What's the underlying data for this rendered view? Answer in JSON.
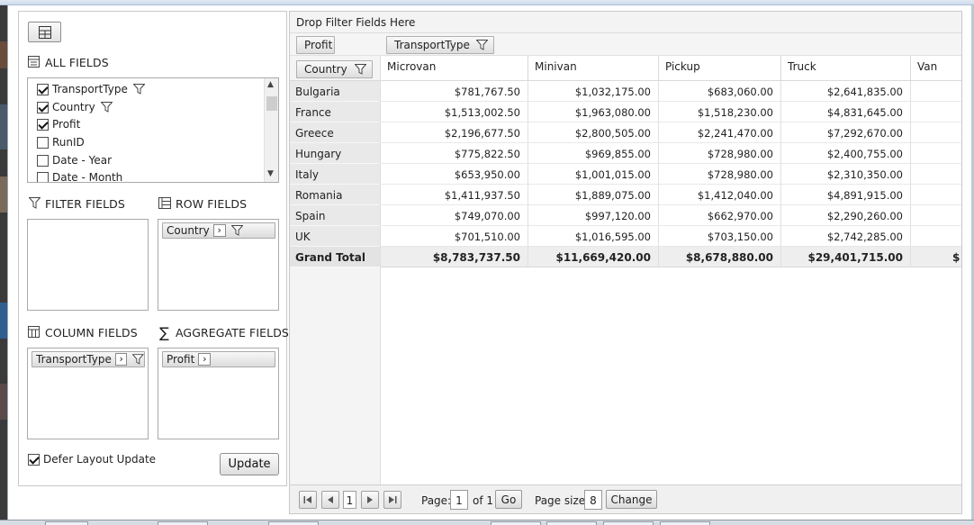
{
  "left_panel": {
    "all_fields_label": "ALL FIELDS",
    "fields": [
      {
        "label": "TransportType",
        "checked": true,
        "filtered": true
      },
      {
        "label": "Country",
        "checked": true,
        "filtered": true
      },
      {
        "label": "Profit",
        "checked": true,
        "filtered": false
      },
      {
        "label": "RunID",
        "checked": false,
        "filtered": false
      },
      {
        "label": "Date - Year",
        "checked": false,
        "filtered": false
      },
      {
        "label": "Date - Month",
        "checked": false,
        "filtered": false
      }
    ],
    "filter_fields_label": "FILTER FIELDS",
    "row_fields_label": "ROW FIELDS",
    "row_field_chip": "Country",
    "column_fields_label": "COLUMN FIELDS",
    "column_field_chip": "TransportType",
    "aggregate_fields_label": "AGGREGATE FIELDS",
    "aggregate_field_chip": "Profit",
    "defer_label": "Defer Layout Update",
    "defer_checked": true,
    "update_label": "Update"
  },
  "grid": {
    "drop_filter_text": "Drop Filter Fields Here",
    "measure_chip": "Profit",
    "column_chip": "TransportType",
    "row_chip": "Country",
    "columns": [
      "Microvan",
      "Minivan",
      "Pickup",
      "Truck",
      "Van"
    ],
    "rows": [
      {
        "label": "Bulgaria",
        "values": [
          "$781,767.50",
          "$1,032,175.00",
          "$683,060.00",
          "$2,641,835.00"
        ]
      },
      {
        "label": "France",
        "values": [
          "$1,513,002.50",
          "$1,963,080.00",
          "$1,518,230.00",
          "$4,831,645.00"
        ]
      },
      {
        "label": "Greece",
        "values": [
          "$2,196,677.50",
          "$2,800,505.00",
          "$2,241,470.00",
          "$7,292,670.00"
        ]
      },
      {
        "label": "Hungary",
        "values": [
          "$775,822.50",
          "$969,855.00",
          "$728,980.00",
          "$2,400,755.00"
        ]
      },
      {
        "label": "Italy",
        "values": [
          "$653,950.00",
          "$1,001,015.00",
          "$728,980.00",
          "$2,310,350.00"
        ]
      },
      {
        "label": "Romania",
        "values": [
          "$1,411,937.50",
          "$1,889,075.00",
          "$1,412,040.00",
          "$4,891,915.00"
        ]
      },
      {
        "label": "Spain",
        "values": [
          "$749,070.00",
          "$997,120.00",
          "$662,970.00",
          "$2,290,260.00"
        ]
      },
      {
        "label": "UK",
        "values": [
          "$701,510.00",
          "$1,016,595.00",
          "$703,150.00",
          "$2,742,285.00"
        ]
      }
    ],
    "total": {
      "label": "Grand Total",
      "values": [
        "$8,783,737.50",
        "$11,669,420.00",
        "$8,678,880.00",
        "$29,401,715.00",
        "$"
      ]
    }
  },
  "pager": {
    "current_page_button": "1",
    "page_label": "Page:",
    "page_value": "1",
    "of_label": "of 1",
    "go_label": "Go",
    "page_size_label": "Page size:",
    "page_size_value": "8",
    "change_label": "Change"
  }
}
